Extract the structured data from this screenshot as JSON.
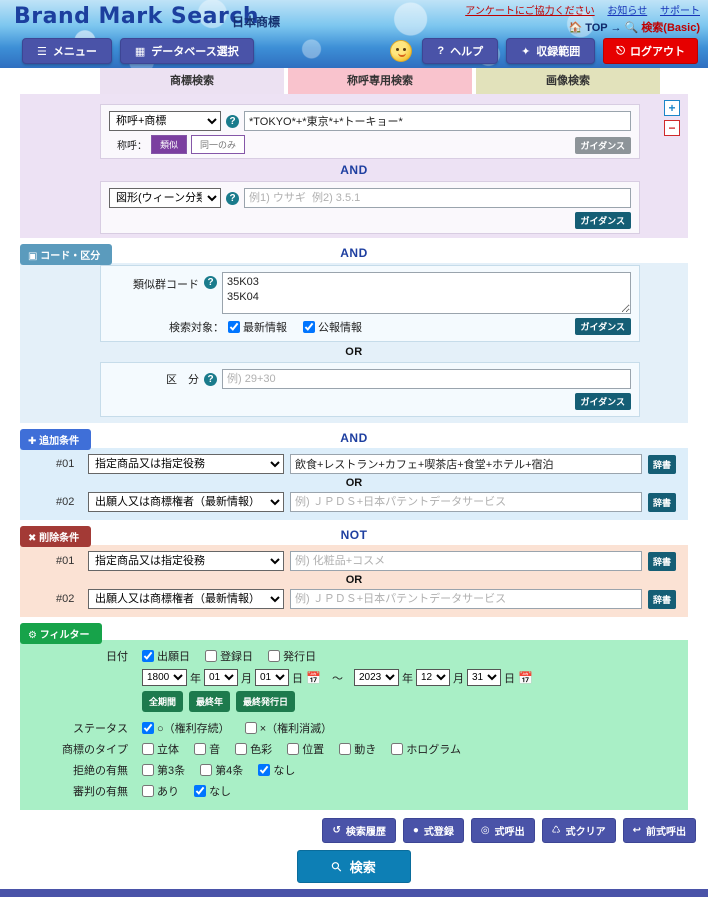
{
  "header": {
    "brand": "Brand Mark Search",
    "brand_sub": "日本商標",
    "links": [
      {
        "label": "アンケートにご協力ください",
        "style": "red"
      },
      {
        "label": "お知らせ",
        "style": "blue"
      },
      {
        "label": "サポート",
        "style": "blue"
      }
    ],
    "breadcrumb_home": "TOP",
    "breadcrumb_arrow": "→",
    "breadcrumb_current": "検索(Basic)",
    "nav_menu": "メニュー",
    "nav_db": "データベース選択",
    "help": "ヘルプ",
    "coverage": "収録範囲",
    "logout": "ログアウト"
  },
  "tabs": [
    {
      "label": "商標検索",
      "active": true
    },
    {
      "label": "称呼専用検索",
      "active": false
    },
    {
      "label": "画像検索",
      "active": false
    }
  ],
  "search": {
    "row1": {
      "select_value": "称呼+商標",
      "input_value": "*TOKYO*+*東京*+*トーキョー*",
      "toggle_label": "称呼：",
      "toggle_on": "類似",
      "toggle_off": "同一のみ",
      "guidance": "ガイダンス"
    },
    "conj_1": "AND",
    "row2": {
      "select_value": "図形(ウィーン分類)",
      "placeholder": "例1) ウサギ  例2) 3.5.1",
      "input_value": "",
      "guidance": "ガイダンス"
    },
    "plus": "+",
    "minus": "−"
  },
  "code_section": {
    "badge": "コード・区分",
    "conj": "AND",
    "similar_label": "類似群コード",
    "similar_value": "35K03\n35K04",
    "target_label": "検索対象：",
    "target_options": [
      {
        "label": "最新情報",
        "checked": true
      },
      {
        "label": "公報情報",
        "checked": true
      }
    ],
    "guidance": "ガイダンス",
    "or": "OR",
    "class_label": "区　分",
    "class_placeholder": "例) 29+30",
    "class_value": "",
    "guidance2": "ガイダンス"
  },
  "add_section": {
    "badge": "追加条件",
    "conj": "AND",
    "or": "OR",
    "rows": [
      {
        "num": "#01",
        "select_value": "指定商品又は指定役務",
        "input_value": "飲食+レストラン+カフェ+喫茶店+食堂+ホテル+宿泊",
        "placeholder": "",
        "dict": "辞書"
      },
      {
        "num": "#02",
        "select_value": "出願人又は商標権者（最新情報）",
        "input_value": "",
        "placeholder": "例) ＪＰＤＳ+日本パテントデータサービス",
        "dict": "辞書"
      }
    ]
  },
  "del_section": {
    "badge": "削除条件",
    "conj": "NOT",
    "or": "OR",
    "rows": [
      {
        "num": "#01",
        "select_value": "指定商品又は指定役務",
        "input_value": "",
        "placeholder": "例) 化粧品+コスメ",
        "dict": "辞書"
      },
      {
        "num": "#02",
        "select_value": "出願人又は商標権者（最新情報）",
        "input_value": "",
        "placeholder": "例) ＪＰＤＳ+日本パテントデータサービス",
        "dict": "辞書"
      }
    ]
  },
  "filter_section": {
    "badge": "フィルター",
    "date_label": "日付",
    "date_types": [
      {
        "label": "出願日",
        "checked": true
      },
      {
        "label": "登録日",
        "checked": false
      },
      {
        "label": "発行日",
        "checked": false
      }
    ],
    "from_year": "1800",
    "from_month": "01",
    "from_day": "01",
    "to_year": "2023",
    "to_month": "12",
    "to_day": "31",
    "unit_year": "年",
    "unit_month": "月",
    "unit_day": "日",
    "range_sep": "～",
    "date_buttons": [
      "全期間",
      "最終年",
      "最終発行日"
    ],
    "status_label": "ステータス",
    "status_options": [
      {
        "label": "○（権利存続）",
        "checked": true
      },
      {
        "label": "×（権利消滅）",
        "checked": false
      }
    ],
    "type_label": "商標のタイプ",
    "type_options": [
      {
        "label": "立体",
        "checked": false
      },
      {
        "label": "音",
        "checked": false
      },
      {
        "label": "色彩",
        "checked": false
      },
      {
        "label": "位置",
        "checked": false
      },
      {
        "label": "動き",
        "checked": false
      },
      {
        "label": "ホログラム",
        "checked": false
      }
    ],
    "reject_label": "拒絶の有無",
    "reject_options": [
      {
        "label": "第3条",
        "checked": false
      },
      {
        "label": "第4条",
        "checked": false
      },
      {
        "label": "なし",
        "checked": true
      }
    ],
    "trial_label": "審判の有無",
    "trial_options": [
      {
        "label": "あり",
        "checked": false
      },
      {
        "label": "なし",
        "checked": true
      }
    ]
  },
  "footer": {
    "buttons": [
      {
        "label": "検索履歴",
        "icon": "history-icon"
      },
      {
        "label": "式登録",
        "icon": "save-icon"
      },
      {
        "label": "式呼出",
        "icon": "load-icon"
      },
      {
        "label": "式クリア",
        "icon": "clear-icon"
      },
      {
        "label": "前式呼出",
        "icon": "back-icon"
      }
    ],
    "search_label": "検索"
  }
}
